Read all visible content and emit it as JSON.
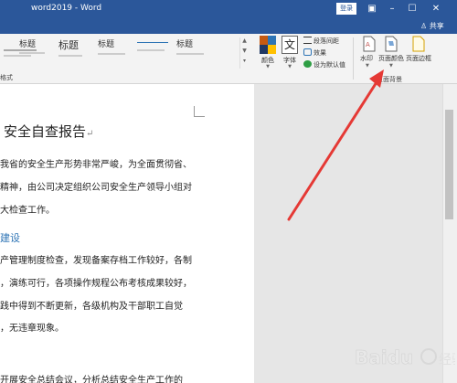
{
  "titlebar": {
    "doc_title": "word2019 - Word",
    "login_label": "登录"
  },
  "tabs": {
    "share_label": "共享"
  },
  "styles_gallery": {
    "items": [
      {
        "label": "标题"
      },
      {
        "label": "标题"
      },
      {
        "label": "标题"
      },
      {
        "label": ""
      },
      {
        "label": "标题"
      }
    ]
  },
  "ribbon": {
    "colors_label": "颜色",
    "fonts_label": "字体",
    "paragraph_spacing_label": "段落间距",
    "effects_label": "效果",
    "set_default_label": "设为默认值",
    "watermark_label": "水印",
    "page_color_label": "页面颜色",
    "page_border_label": "页面边框",
    "page_background_group": "页面背景",
    "format_group_partial": "格式"
  },
  "document": {
    "title": "安全自查报告",
    "lines": [
      "我省的安全生产形势非常严峻，为全面贯彻省、",
      "精神，由公司决定组织公司安全生产领导小组对",
      "大检查工作。"
    ],
    "heading": "建设",
    "lines2": [
      "产管理制度检查，发现备案存档工作较好，各制",
      "，演练可行，各项操作规程公布考核成果较好，",
      "践中得到不断更新，各级机构及干部职工自觉",
      "，无违章现象。"
    ],
    "lines3": [
      "开展安全总结会议，分析总结安全生产工作的"
    ]
  },
  "colors": {
    "titlebar_bg": "#2b579a",
    "arrow": "#e53935",
    "heading_blue": "#2e74b5"
  }
}
